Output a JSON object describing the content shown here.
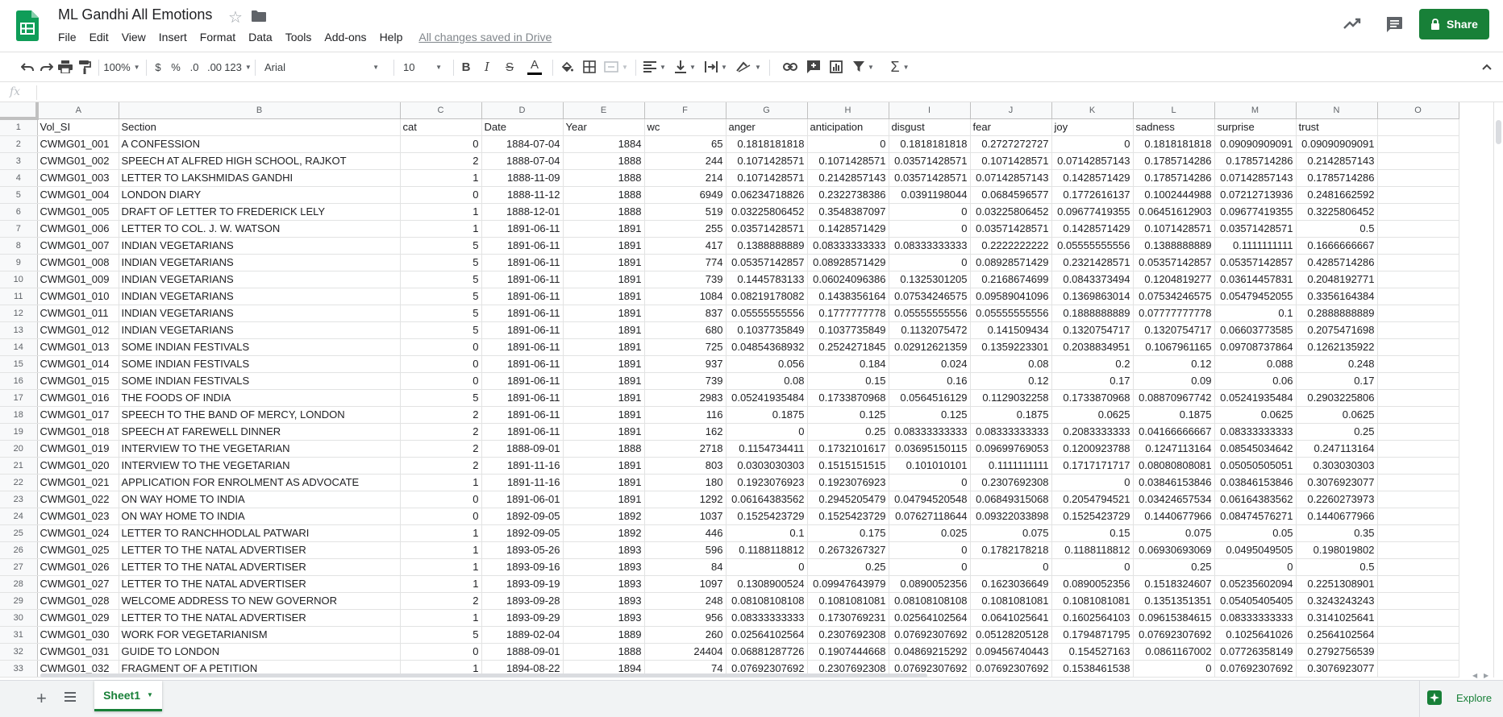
{
  "document": {
    "title": "ML Gandhi All Emotions",
    "saved_status": "All changes saved in Drive"
  },
  "menu": [
    "File",
    "Edit",
    "View",
    "Insert",
    "Format",
    "Data",
    "Tools",
    "Add-ons",
    "Help"
  ],
  "share": {
    "label": "Share"
  },
  "toolbar": {
    "zoom": "100%",
    "currency": "$",
    "percent": "%",
    "decrease_decimals": ".0",
    "increase_decimals": ".00",
    "more_formats": "123",
    "font": "Arial",
    "font_size": "10",
    "bold": "B",
    "italic": "I",
    "strike": "S",
    "text_color": "A"
  },
  "formula": {
    "fx": "fx",
    "value": ""
  },
  "columns": [
    "A",
    "B",
    "C",
    "D",
    "E",
    "F",
    "G",
    "H",
    "I",
    "J",
    "K",
    "L",
    "M",
    "N",
    "O"
  ],
  "headers": [
    "Vol_SI",
    "Section",
    "cat",
    "Date",
    "Year",
    "wc",
    "anger",
    "anticipation",
    "disgust",
    "fear",
    "joy",
    "sadness",
    "surprise",
    "trust",
    ""
  ],
  "rows": [
    [
      "CWMG01_001",
      "A CONFESSION",
      "0",
      "1884-07-04",
      "1884",
      "65",
      "0.1818181818",
      "0",
      "0.1818181818",
      "0.2727272727",
      "0",
      "0.1818181818",
      "0.09090909091",
      "0.09090909091"
    ],
    [
      "CWMG01_002",
      "SPEECH AT ALFRED HIGH SCHOOL, RAJKOT",
      "2",
      "1888-07-04",
      "1888",
      "244",
      "0.1071428571",
      "0.1071428571",
      "0.03571428571",
      "0.1071428571",
      "0.07142857143",
      "0.1785714286",
      "0.1785714286",
      "0.2142857143"
    ],
    [
      "CWMG01_003",
      "LETTER TO LAKSHMIDAS GANDHI",
      "1",
      "1888-11-09",
      "1888",
      "214",
      "0.1071428571",
      "0.2142857143",
      "0.03571428571",
      "0.07142857143",
      "0.1428571429",
      "0.1785714286",
      "0.07142857143",
      "0.1785714286"
    ],
    [
      "CWMG01_004",
      "LONDON DIARY",
      "0",
      "1888-11-12",
      "1888",
      "6949",
      "0.06234718826",
      "0.2322738386",
      "0.0391198044",
      "0.0684596577",
      "0.1772616137",
      "0.1002444988",
      "0.07212713936",
      "0.2481662592"
    ],
    [
      "CWMG01_005",
      "DRAFT OF LETTER TO FREDERICK LELY",
      "1",
      "1888-12-01",
      "1888",
      "519",
      "0.03225806452",
      "0.3548387097",
      "0",
      "0.03225806452",
      "0.09677419355",
      "0.06451612903",
      "0.09677419355",
      "0.3225806452"
    ],
    [
      "CWMG01_006",
      "LETTER TO COL. J. W. WATSON",
      "1",
      "1891-06-11",
      "1891",
      "255",
      "0.03571428571",
      "0.1428571429",
      "0",
      "0.03571428571",
      "0.1428571429",
      "0.1071428571",
      "0.03571428571",
      "0.5"
    ],
    [
      "CWMG01_007",
      "INDIAN VEGETARIANS",
      "5",
      "1891-06-11",
      "1891",
      "417",
      "0.1388888889",
      "0.08333333333",
      "0.08333333333",
      "0.2222222222",
      "0.05555555556",
      "0.1388888889",
      "0.1111111111",
      "0.1666666667"
    ],
    [
      "CWMG01_008",
      "INDIAN VEGETARIANS",
      "5",
      "1891-06-11",
      "1891",
      "774",
      "0.05357142857",
      "0.08928571429",
      "0",
      "0.08928571429",
      "0.2321428571",
      "0.05357142857",
      "0.05357142857",
      "0.4285714286"
    ],
    [
      "CWMG01_009",
      "INDIAN VEGETARIANS",
      "5",
      "1891-06-11",
      "1891",
      "739",
      "0.1445783133",
      "0.06024096386",
      "0.1325301205",
      "0.2168674699",
      "0.0843373494",
      "0.1204819277",
      "0.03614457831",
      "0.2048192771"
    ],
    [
      "CWMG01_010",
      "INDIAN VEGETARIANS",
      "5",
      "1891-06-11",
      "1891",
      "1084",
      "0.08219178082",
      "0.1438356164",
      "0.07534246575",
      "0.09589041096",
      "0.1369863014",
      "0.07534246575",
      "0.05479452055",
      "0.3356164384"
    ],
    [
      "CWMG01_011",
      "INDIAN VEGETARIANS",
      "5",
      "1891-06-11",
      "1891",
      "837",
      "0.05555555556",
      "0.1777777778",
      "0.05555555556",
      "0.05555555556",
      "0.1888888889",
      "0.07777777778",
      "0.1",
      "0.2888888889"
    ],
    [
      "CWMG01_012",
      "INDIAN VEGETARIANS",
      "5",
      "1891-06-11",
      "1891",
      "680",
      "0.1037735849",
      "0.1037735849",
      "0.1132075472",
      "0.141509434",
      "0.1320754717",
      "0.1320754717",
      "0.06603773585",
      "0.2075471698"
    ],
    [
      "CWMG01_013",
      "SOME INDIAN FESTIVALS",
      "0",
      "1891-06-11",
      "1891",
      "725",
      "0.04854368932",
      "0.2524271845",
      "0.02912621359",
      "0.1359223301",
      "0.2038834951",
      "0.1067961165",
      "0.09708737864",
      "0.1262135922"
    ],
    [
      "CWMG01_014",
      "SOME INDIAN FESTIVALS",
      "0",
      "1891-06-11",
      "1891",
      "937",
      "0.056",
      "0.184",
      "0.024",
      "0.08",
      "0.2",
      "0.12",
      "0.088",
      "0.248"
    ],
    [
      "CWMG01_015",
      "SOME INDIAN FESTIVALS",
      "0",
      "1891-06-11",
      "1891",
      "739",
      "0.08",
      "0.15",
      "0.16",
      "0.12",
      "0.17",
      "0.09",
      "0.06",
      "0.17"
    ],
    [
      "CWMG01_016",
      "THE FOODS OF INDIA",
      "5",
      "1891-06-11",
      "1891",
      "2983",
      "0.05241935484",
      "0.1733870968",
      "0.0564516129",
      "0.1129032258",
      "0.1733870968",
      "0.08870967742",
      "0.05241935484",
      "0.2903225806"
    ],
    [
      "CWMG01_017",
      "SPEECH TO THE BAND OF MERCY, LONDON",
      "2",
      "1891-06-11",
      "1891",
      "116",
      "0.1875",
      "0.125",
      "0.125",
      "0.1875",
      "0.0625",
      "0.1875",
      "0.0625",
      "0.0625"
    ],
    [
      "CWMG01_018",
      "SPEECH AT FAREWELL DINNER",
      "2",
      "1891-06-11",
      "1891",
      "162",
      "0",
      "0.25",
      "0.08333333333",
      "0.08333333333",
      "0.2083333333",
      "0.04166666667",
      "0.08333333333",
      "0.25"
    ],
    [
      "CWMG01_019",
      "INTERVIEW TO THE VEGETARIAN",
      "2",
      "1888-09-01",
      "1888",
      "2718",
      "0.1154734411",
      "0.1732101617",
      "0.03695150115",
      "0.09699769053",
      "0.1200923788",
      "0.1247113164",
      "0.08545034642",
      "0.247113164"
    ],
    [
      "CWMG01_020",
      "INTERVIEW TO THE VEGETARIAN",
      "2",
      "1891-11-16",
      "1891",
      "803",
      "0.0303030303",
      "0.1515151515",
      "0.101010101",
      "0.1111111111",
      "0.1717171717",
      "0.08080808081",
      "0.05050505051",
      "0.303030303"
    ],
    [
      "CWMG01_021",
      "APPLICATION FOR ENROLMENT AS ADVOCATE",
      "1",
      "1891-11-16",
      "1891",
      "180",
      "0.1923076923",
      "0.1923076923",
      "0",
      "0.2307692308",
      "0",
      "0.03846153846",
      "0.03846153846",
      "0.3076923077"
    ],
    [
      "CWMG01_022",
      "ON WAY HOME TO INDIA",
      "0",
      "1891-06-01",
      "1891",
      "1292",
      "0.06164383562",
      "0.2945205479",
      "0.04794520548",
      "0.06849315068",
      "0.2054794521",
      "0.03424657534",
      "0.06164383562",
      "0.2260273973"
    ],
    [
      "CWMG01_023",
      "ON WAY HOME TO INDIA",
      "0",
      "1892-09-05",
      "1892",
      "1037",
      "0.1525423729",
      "0.1525423729",
      "0.07627118644",
      "0.09322033898",
      "0.1525423729",
      "0.1440677966",
      "0.08474576271",
      "0.1440677966"
    ],
    [
      "CWMG01_024",
      "LETTER TO RANCHHODLAL PATWARI",
      "1",
      "1892-09-05",
      "1892",
      "446",
      "0.1",
      "0.175",
      "0.025",
      "0.075",
      "0.15",
      "0.075",
      "0.05",
      "0.35"
    ],
    [
      "CWMG01_025",
      "LETTER TO THE NATAL ADVERTISER",
      "1",
      "1893-05-26",
      "1893",
      "596",
      "0.1188118812",
      "0.2673267327",
      "0",
      "0.1782178218",
      "0.1188118812",
      "0.06930693069",
      "0.0495049505",
      "0.198019802"
    ],
    [
      "CWMG01_026",
      "LETTER TO THE NATAL ADVERTISER",
      "1",
      "1893-09-16",
      "1893",
      "84",
      "0",
      "0.25",
      "0",
      "0",
      "0",
      "0.25",
      "0",
      "0.5"
    ],
    [
      "CWMG01_027",
      "LETTER TO THE NATAL ADVERTISER",
      "1",
      "1893-09-19",
      "1893",
      "1097",
      "0.1308900524",
      "0.09947643979",
      "0.0890052356",
      "0.1623036649",
      "0.0890052356",
      "0.1518324607",
      "0.05235602094",
      "0.2251308901"
    ],
    [
      "CWMG01_028",
      "WELCOME ADDRESS TO NEW GOVERNOR",
      "2",
      "1893-09-28",
      "1893",
      "248",
      "0.08108108108",
      "0.1081081081",
      "0.08108108108",
      "0.1081081081",
      "0.1081081081",
      "0.1351351351",
      "0.05405405405",
      "0.3243243243"
    ],
    [
      "CWMG01_029",
      "LETTER TO THE NATAL ADVERTISER",
      "1",
      "1893-09-29",
      "1893",
      "956",
      "0.08333333333",
      "0.1730769231",
      "0.02564102564",
      "0.0641025641",
      "0.1602564103",
      "0.09615384615",
      "0.08333333333",
      "0.3141025641"
    ],
    [
      "CWMG01_030",
      "WORK FOR VEGETARIANISM",
      "5",
      "1889-02-04",
      "1889",
      "260",
      "0.02564102564",
      "0.2307692308",
      "0.07692307692",
      "0.05128205128",
      "0.1794871795",
      "0.07692307692",
      "0.1025641026",
      "0.2564102564"
    ],
    [
      "CWMG01_031",
      "GUIDE TO LONDON",
      "0",
      "1888-09-01",
      "1888",
      "24404",
      "0.06881287726",
      "0.1907444668",
      "0.04869215292",
      "0.09456740443",
      "0.154527163",
      "0.0861167002",
      "0.07726358149",
      "0.2792756539"
    ],
    [
      "CWMG01_032",
      "FRAGMENT OF A PETITION",
      "1",
      "1894-08-22",
      "1894",
      "74",
      "0.07692307692",
      "0.2307692308",
      "0.07692307692",
      "0.07692307692",
      "0.1538461538",
      "0",
      "0.07692307692",
      "0.3076923077"
    ]
  ],
  "sheet_tabs": [
    {
      "label": "Sheet1"
    }
  ],
  "explore": {
    "label": "Explore"
  },
  "colors": {
    "brand_green": "#188038",
    "grid_line": "#e2e3e3",
    "header_bg": "#f8f9fa"
  }
}
